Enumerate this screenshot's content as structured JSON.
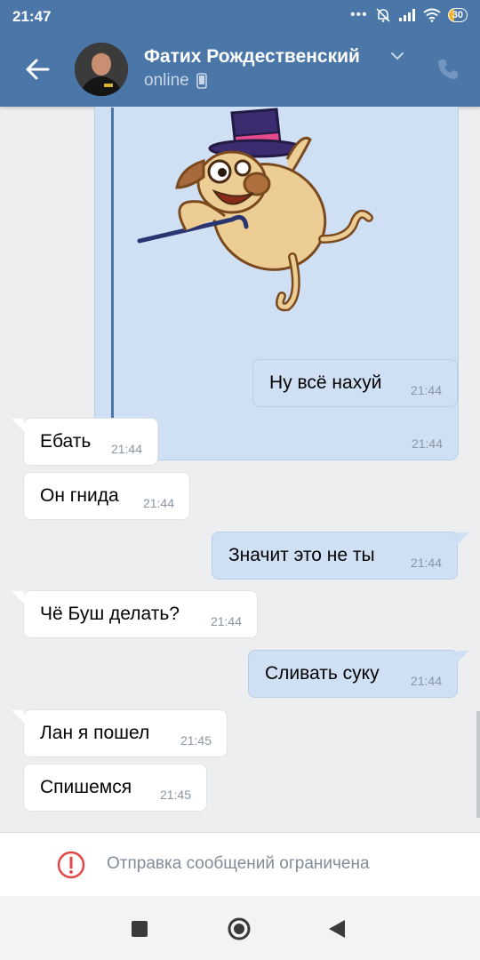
{
  "status_bar": {
    "time": "21:47",
    "battery": "30"
  },
  "header": {
    "contact_name": "Фатих Рождественский",
    "status": "online"
  },
  "sticker": {
    "time": "21:44"
  },
  "messages": [
    {
      "dir": "out",
      "text": "Ну всё нахуй",
      "time": "21:44"
    },
    {
      "dir": "in",
      "text": "Ебать",
      "time": "21:44"
    },
    {
      "dir": "in",
      "text": "Он гнида",
      "time": "21:44"
    },
    {
      "dir": "out",
      "text": "Значит это не ты",
      "time": "21:44"
    },
    {
      "dir": "in",
      "text": "Чё Буш делать?",
      "time": "21:44"
    },
    {
      "dir": "out",
      "text": "Сливать суку",
      "time": "21:44"
    },
    {
      "dir": "in",
      "text": "Лан я пошел",
      "time": "21:45"
    },
    {
      "dir": "in",
      "text": "Спишемся",
      "time": "21:45"
    }
  ],
  "restricted_notice": "Отправка сообщений ограничена",
  "colors": {
    "header": "#4a76a8",
    "outgoing_bubble": "#cfe0f5",
    "incoming_bubble": "#ffffff",
    "warning": "#e64646"
  },
  "icons": [
    "back-arrow-icon",
    "phone-icon",
    "mobile-icon",
    "chevron-down-icon",
    "warning-icon",
    "sticker-dog-with-top-hat",
    "nav-recents-icon",
    "nav-home-icon",
    "nav-back-icon"
  ]
}
